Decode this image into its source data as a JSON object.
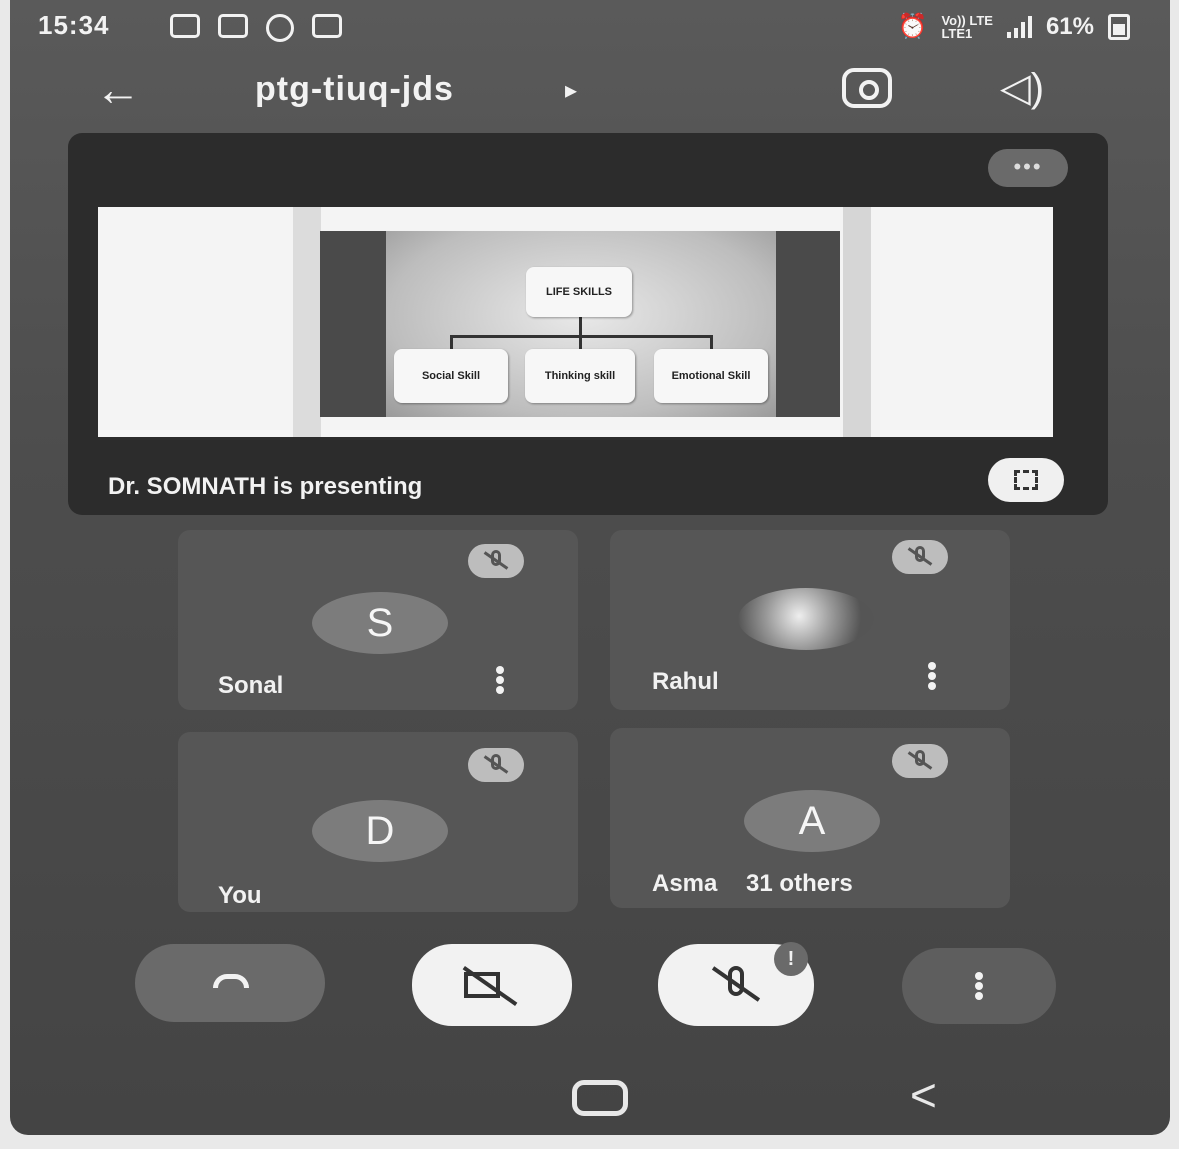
{
  "status_bar": {
    "time": "15:34",
    "network_top": "Vo)) LTE",
    "network_bottom": "LTE1",
    "battery": "61%"
  },
  "header": {
    "back_icon": "←",
    "meeting_code": "ptg-tiuq-jds",
    "code_arrow": "▸",
    "speaker_icon": "◁)"
  },
  "presentation": {
    "more_label": "•••",
    "slide": {
      "title": "LIFE SKILLS",
      "children": [
        "Social Skill",
        "Thinking skill",
        "Emotional Skill"
      ]
    },
    "presenting_text": "Dr. SOMNATH is presenting"
  },
  "participants": [
    {
      "initial": "S",
      "name": "Sonal"
    },
    {
      "initial": "",
      "name": "Rahul"
    },
    {
      "initial": "D",
      "name": "You"
    },
    {
      "initial": "A",
      "name": "Asma",
      "extra": "31 others"
    }
  ],
  "controls": {
    "alert_badge": "!"
  },
  "nav": {
    "back_glyph": "<"
  },
  "colors": {
    "background": "#4d4d4d",
    "card": "#2c2c2c",
    "tile": "#565656",
    "control_light": "#f2f2f2"
  }
}
